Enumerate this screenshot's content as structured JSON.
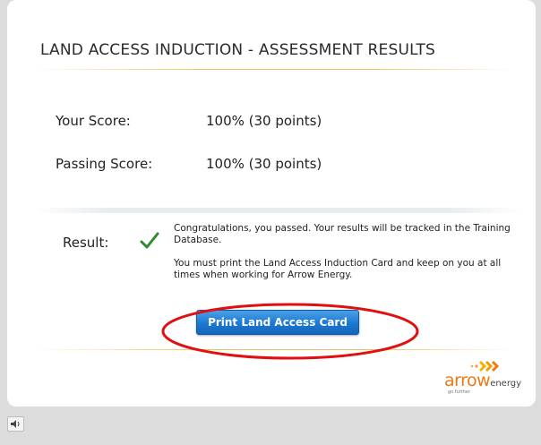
{
  "slide": {
    "title": "LAND ACCESS INDUCTION - ASSESSMENT RESULTS"
  },
  "scores": [
    {
      "label": "Your Score:",
      "value": "100% (30 points)"
    },
    {
      "label": "Passing Score:",
      "value": "100% (30 points)"
    }
  ],
  "result": {
    "label": "Result:",
    "status_icon": "checkmark-icon",
    "message_1": "Congratulations, you passed. Your results will be tracked in the Training Database.",
    "message_2": "You must print the Land Access Induction Card and keep on you at all times when working for Arrow Energy."
  },
  "print_button": {
    "label": "Print Land Access Card"
  },
  "logo": {
    "word_main": "arrow",
    "word_small": "energy",
    "tagline": "go further"
  },
  "player": {
    "audio_icon": "speaker-icon"
  },
  "colors": {
    "accent_orange": "#ee7a16",
    "button_blue": "#1c78d2",
    "highlight_red": "#e01010",
    "check_green": "#2e8b2e",
    "rule_gold": "#f0c45c"
  }
}
